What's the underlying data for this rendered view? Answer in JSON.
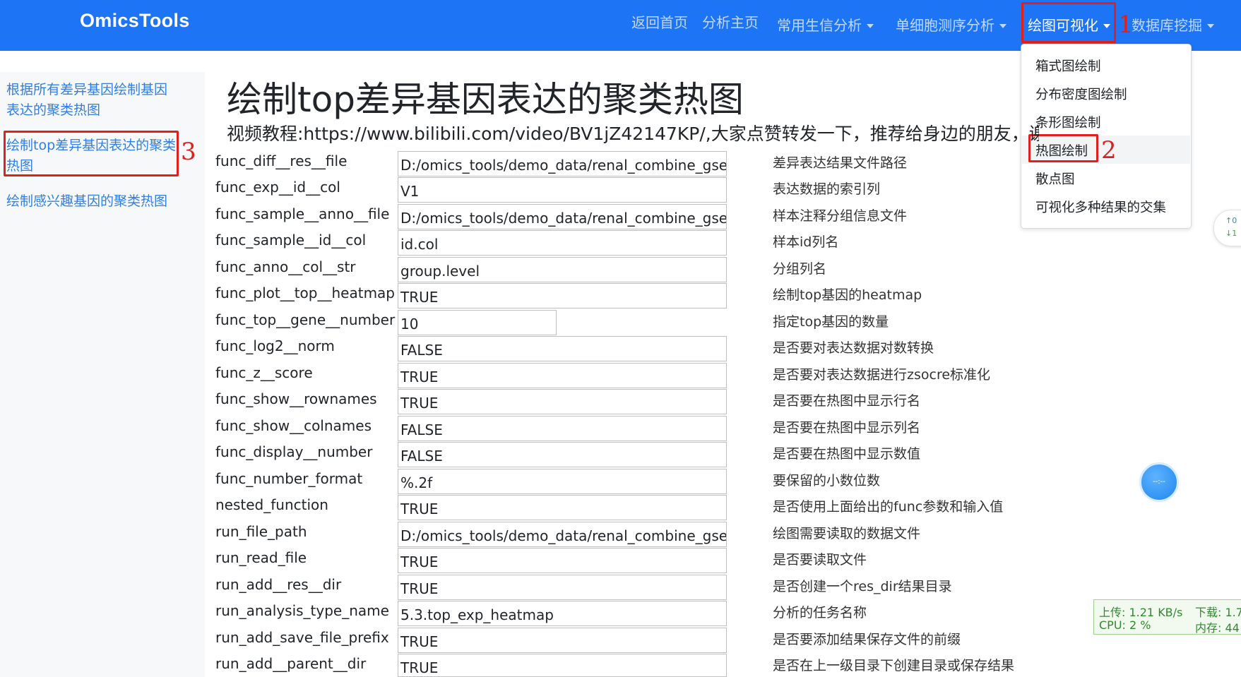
{
  "navbar": {
    "brand": "OmicsTools",
    "items": [
      {
        "label": "返回首页"
      },
      {
        "label": "分析主页"
      },
      {
        "label": "常用生信分析"
      },
      {
        "label": "单细胞测序分析"
      },
      {
        "label": "绘图可视化"
      },
      {
        "label": "数据库挖掘"
      }
    ]
  },
  "annotations": {
    "one": "1",
    "two": "2",
    "three": "3"
  },
  "dropdown": {
    "items": [
      {
        "label": "箱式图绘制"
      },
      {
        "label": "分布密度图绘制"
      },
      {
        "label": "条形图绘制"
      },
      {
        "label": "热图绘制"
      },
      {
        "label": "散点图"
      },
      {
        "label": "可视化多种结果的交集"
      }
    ]
  },
  "sidebar": {
    "items": [
      {
        "label": "根据所有差异基因绘制基因表达的聚类热图"
      },
      {
        "label": "绘制top差异基因表达的聚类热图"
      },
      {
        "label": "绘制感兴趣基因的聚类热图"
      }
    ]
  },
  "main": {
    "title": "绘制top差异基因表达的聚类热图",
    "subtitle": "视频教程:https://www.bilibili.com/video/BV1jZ42147KP/,大家点赞转发一下，推荐给身边的朋友，谢",
    "params": [
      {
        "name": "func_diff__res__file",
        "value": "D:/omics_tools/demo_data/renal_combine_gses/",
        "desc": "差异表达结果文件路径"
      },
      {
        "name": "func_exp__id__col",
        "value": "V1",
        "desc": "表达数据的索引列"
      },
      {
        "name": "func_sample__anno__file",
        "value": "D:/omics_tools/demo_data/renal_combine_gses/",
        "desc": "样本注释分组信息文件"
      },
      {
        "name": "func_sample__id__col",
        "value": "id.col",
        "desc": "样本id列名"
      },
      {
        "name": "func_anno__col__str",
        "value": "group.level",
        "desc": "分组列名"
      },
      {
        "name": "func_plot__top__heatmap",
        "value": "TRUE",
        "desc": "绘制top基因的heatmap"
      },
      {
        "name": "func_top__gene__number",
        "value": "10",
        "desc": "指定top基因的数量"
      },
      {
        "name": "func_log2__norm",
        "value": "FALSE",
        "desc": "是否要对表达数据对数转换"
      },
      {
        "name": "func_z__score",
        "value": "TRUE",
        "desc": "是否要对表达数据进行zsocre标准化"
      },
      {
        "name": "func_show__rownames",
        "value": "TRUE",
        "desc": "是否要在热图中显示行名"
      },
      {
        "name": "func_show__colnames",
        "value": "FALSE",
        "desc": "是否要在热图中显示列名"
      },
      {
        "name": "func_display__number",
        "value": "FALSE",
        "desc": "是否要在热图中显示数值"
      },
      {
        "name": "func_number_format",
        "value": "%.2f",
        "desc": "要保留的小数位数"
      },
      {
        "name": "nested_function",
        "value": "TRUE",
        "desc": "是否使用上面给出的func参数和输入值"
      },
      {
        "name": "run_file_path",
        "value": "D:/omics_tools/demo_data/renal_combine_gses/",
        "desc": "绘图需要读取的数据文件"
      },
      {
        "name": "run_read_file",
        "value": "TRUE",
        "desc": "是否要读取文件"
      },
      {
        "name": "run_add__res__dir",
        "value": "TRUE",
        "desc": "是否创建一个res_dir结果目录"
      },
      {
        "name": "run_analysis_type_name",
        "value": "5.3.top_exp_heatmap",
        "desc": "分析的任务名称"
      },
      {
        "name": "run_add_save_file_prefix",
        "value": "TRUE",
        "desc": "是否要添加结果保存文件的前缀"
      },
      {
        "name": "run_add__parent__dir",
        "value": "TRUE",
        "desc": "是否在上一级目录下创建目录或保存结果"
      }
    ]
  },
  "scroll_widget": {
    "up": "↑0",
    "down": "↓1"
  },
  "float_button": {
    "label": "--:--"
  },
  "net_monitor": {
    "upload": "上传: 1.21 KB/s",
    "download": "下载: 1.7",
    "cpu": "CPU: 2 %",
    "memory": "内存: 44"
  }
}
